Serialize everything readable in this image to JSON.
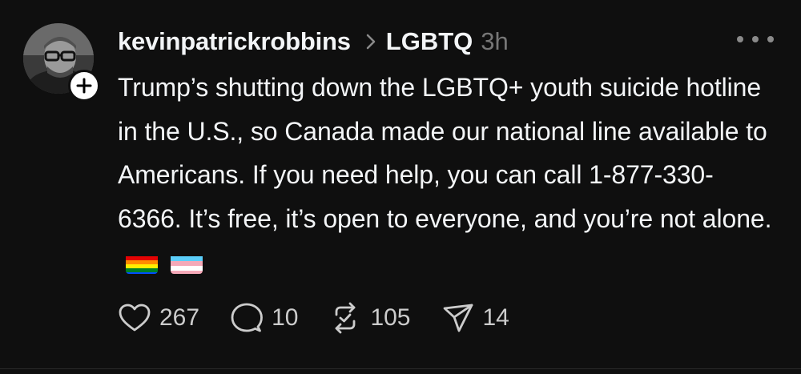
{
  "post": {
    "author": "kevinpatrickrobbins",
    "community": "LGBTQ",
    "time": "3h",
    "text": "Trump’s shutting down the LGBTQ+ youth suicide hotline in the U.S., so Canada made our national line available to Americans. If you need help, you can call 1-877-330-6366. It’s free, it’s open to everyone, and you’re not alone.",
    "emojis": [
      "rainbow-flag",
      "transgender-flag"
    ]
  },
  "actions": {
    "likes": "267",
    "replies": "10",
    "reposts": "105",
    "shares": "14"
  },
  "icons": {
    "like": "heart-icon",
    "reply": "speech-bubble-icon",
    "repost": "repost-icon",
    "share": "paper-plane-icon",
    "more": "more-dots-icon",
    "follow": "plus-icon",
    "breadcrumb": "chevron-right-icon"
  },
  "colors": {
    "background": "#0f0f0f",
    "text": "#f3f5f7",
    "muted": "#777777",
    "counts": "#cccccc"
  }
}
